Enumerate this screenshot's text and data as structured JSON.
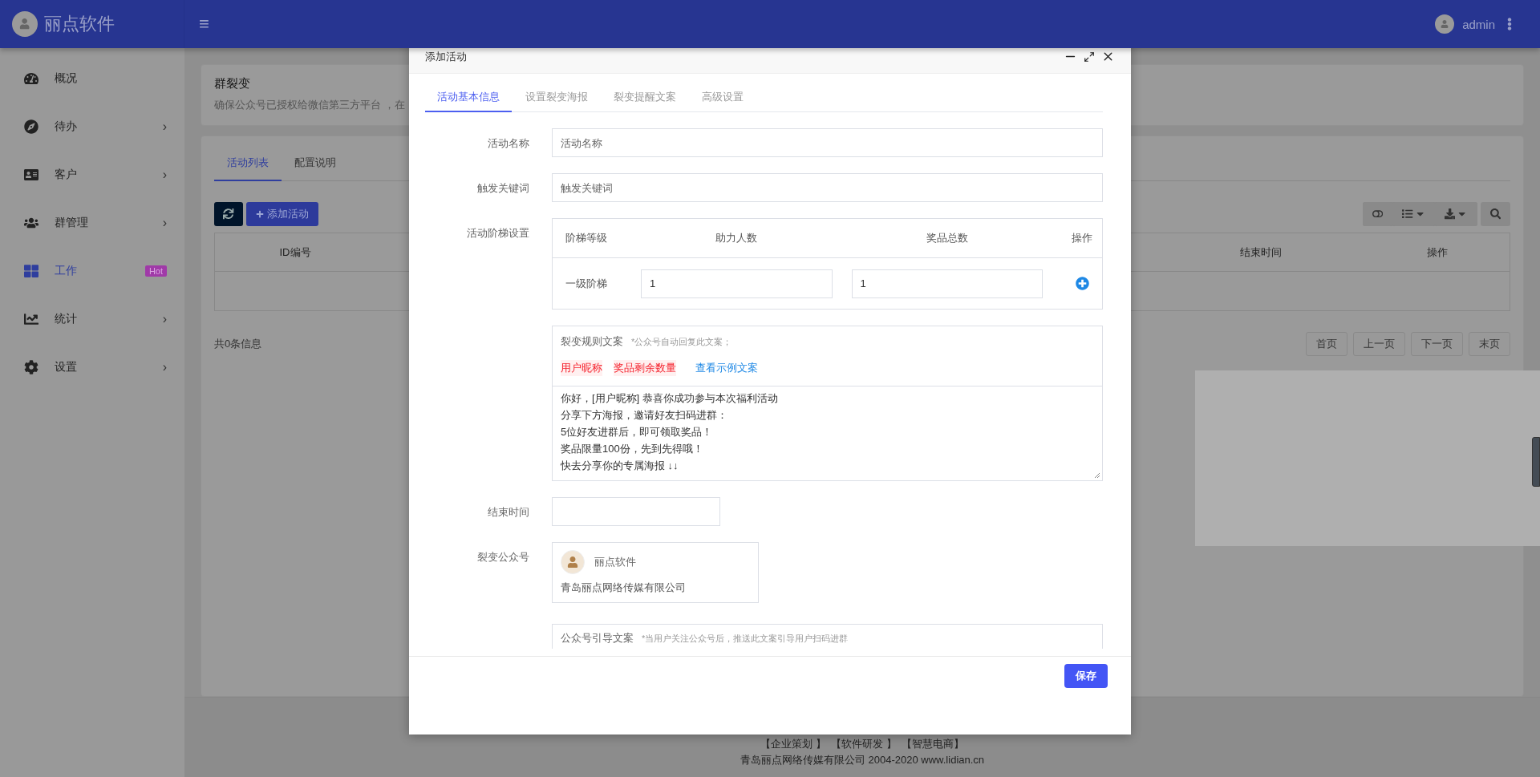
{
  "header": {
    "brand": "丽点软件",
    "menu_icon": "≡",
    "user": "admin"
  },
  "sidebar": {
    "items": [
      {
        "label": "概况",
        "selected": false
      },
      {
        "label": "待办",
        "selected": false,
        "arrow": "›"
      },
      {
        "label": "客户",
        "selected": false,
        "arrow": "›"
      },
      {
        "label": "群管理",
        "selected": false,
        "arrow": "›"
      },
      {
        "label": "工作",
        "selected": true,
        "badge": "Hot"
      },
      {
        "label": "统计",
        "selected": false,
        "arrow": "›"
      },
      {
        "label": "设置",
        "selected": false,
        "arrow": "›"
      }
    ]
  },
  "page": {
    "title": "群裂变",
    "description": "确保公众号已授权给微信第三方平台 ，在",
    "tabs": [
      {
        "label": "活动列表",
        "selected": true
      },
      {
        "label": "配置说明",
        "selected": false
      }
    ],
    "add_button": "添加活动",
    "table": {
      "columns": [
        "ID编号",
        "结束时间",
        "操作"
      ]
    },
    "total": "共0条信息",
    "pagination": [
      "首页",
      "上一页",
      "下一页",
      "末页"
    ]
  },
  "modal": {
    "title": "添加活动",
    "tabs": [
      {
        "label": "活动基本信息",
        "selected": true
      },
      {
        "label": "设置裂变海报",
        "selected": false
      },
      {
        "label": "裂变提醒文案",
        "selected": false
      },
      {
        "label": "高级设置",
        "selected": false
      }
    ],
    "name_field": {
      "label": "活动名称",
      "placeholder": "活动名称"
    },
    "keyword_field": {
      "label": "触发关键词",
      "placeholder": "触发关键词"
    },
    "ladder": {
      "label": "活动阶梯设置",
      "columns": [
        "阶梯等级",
        "助力人数",
        "奖品总数",
        "操作"
      ],
      "rows": [
        {
          "level": "一级阶梯",
          "helpers": "1",
          "prizes": "1"
        }
      ]
    },
    "rule_copy": {
      "title": "裂变规则文案",
      "hint": "*公众号自动回复此文案；",
      "tags": [
        "用户昵称",
        "奖品剩余数量"
      ],
      "example_link": "查看示例文案",
      "lines": [
        "你好，[用户昵称] 恭喜你成功参与本次福利活动",
        "分享下方海报，邀请好友扫码进群：",
        "5位好友进群后，即可领取奖品！",
        "奖品限量100份，先到先得哦！",
        "快去分享你的专属海报 ↓↓"
      ]
    },
    "end_time": {
      "label": "结束时间"
    },
    "account": {
      "label": "裂变公众号",
      "name": "丽点软件",
      "company": "青岛丽点网络传媒有限公司"
    },
    "guide_copy": {
      "title": "公众号引导文案",
      "hint": "*当用户关注公众号后，推送此文案引导用户扫码进群"
    },
    "save_button": "保存"
  },
  "footer": {
    "links": [
      "【企业策划 】",
      "【软件研发 】",
      "【智慧电商】"
    ],
    "copyright": "青岛丽点网络传媒有限公司 2004-2020 www.lidian.cn"
  }
}
